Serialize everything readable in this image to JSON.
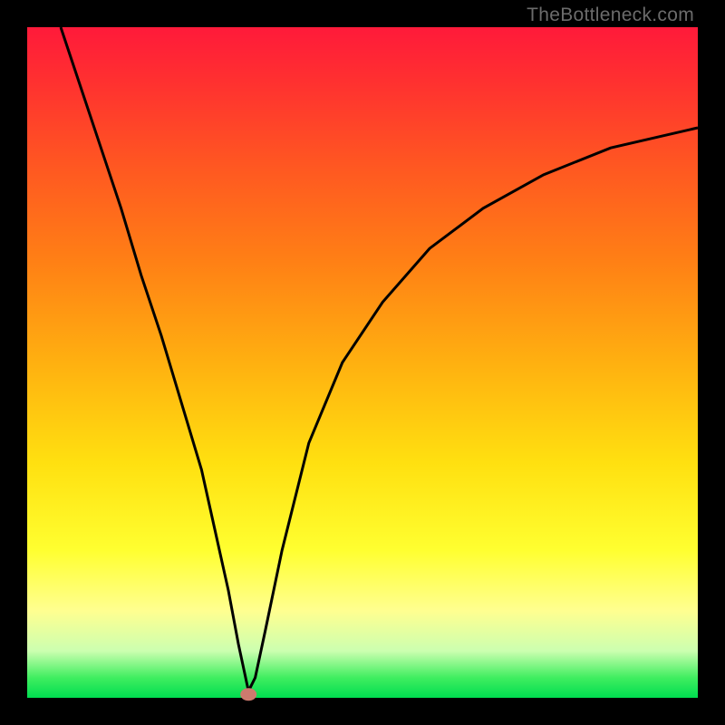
{
  "watermark": "TheBottleneck.com",
  "chart_data": {
    "type": "line",
    "title": "",
    "xlabel": "",
    "ylabel": "",
    "xlim": [
      0,
      100
    ],
    "ylim": [
      0,
      100
    ],
    "grid": false,
    "legend": false,
    "series": [
      {
        "name": "bottleneck-curve",
        "x": [
          5,
          8,
          11,
          14,
          17,
          20,
          23,
          26,
          28,
          30,
          31.5,
          33,
          34,
          35.5,
          38,
          42,
          47,
          53,
          60,
          68,
          77,
          87,
          100
        ],
        "y": [
          100,
          91,
          82,
          73,
          63,
          54,
          44,
          34,
          25,
          16,
          8,
          1,
          3,
          10,
          22,
          38,
          50,
          59,
          67,
          73,
          78,
          82,
          85
        ],
        "note": "V-shaped bottleneck curve. Values are percentages estimated from pixel positions; minimum (optimal point) near x≈33."
      }
    ],
    "marker": {
      "x": 33,
      "y": 0.5,
      "note": "Optimal bottleneck point indicator at base of curve"
    },
    "background_gradient": {
      "stops": [
        {
          "pos": 0,
          "color": "#ff1a3a"
        },
        {
          "pos": 8,
          "color": "#ff3030"
        },
        {
          "pos": 20,
          "color": "#ff5522"
        },
        {
          "pos": 35,
          "color": "#ff8015"
        },
        {
          "pos": 50,
          "color": "#ffb010"
        },
        {
          "pos": 65,
          "color": "#ffe010"
        },
        {
          "pos": 78,
          "color": "#ffff30"
        },
        {
          "pos": 87,
          "color": "#ffff90"
        },
        {
          "pos": 93,
          "color": "#ccffb0"
        },
        {
          "pos": 97,
          "color": "#40ee60"
        },
        {
          "pos": 100,
          "color": "#00dd50"
        }
      ],
      "note": "Red (top, high bottleneck) to green (bottom, optimal) vertical gradient"
    }
  }
}
